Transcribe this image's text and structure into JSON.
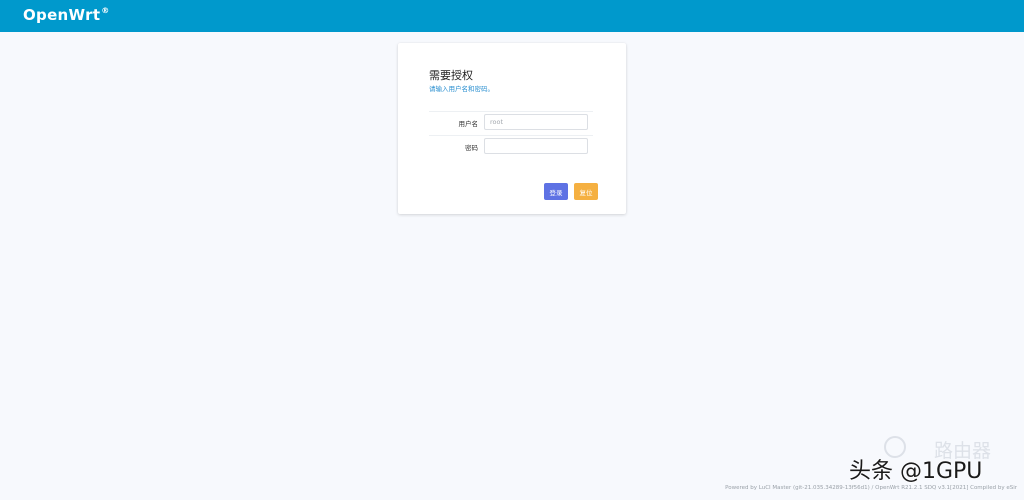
{
  "header": {
    "brand": "OpenWrt",
    "brand_mark": "®",
    "bg_color": "#0099cc"
  },
  "login": {
    "title": "需要授权",
    "subtitle": "请输入用户名和密码。",
    "username_label": "用户名",
    "username_placeholder": "root",
    "username_value": "",
    "password_label": "密码",
    "password_value": "",
    "login_button": "登录",
    "reset_button": "复位",
    "login_color": "#5e72e4",
    "reset_color": "#f5b041"
  },
  "footer": {
    "text": "Powered by LuCI Master (git-21.035.34289-13f56d1) / OpenWrt R21.2.1 SDQ v3.1[2021] Compiled by eSir"
  },
  "watermark": {
    "ghost_text": "路由器",
    "main_text": "头条 @1GPU"
  }
}
